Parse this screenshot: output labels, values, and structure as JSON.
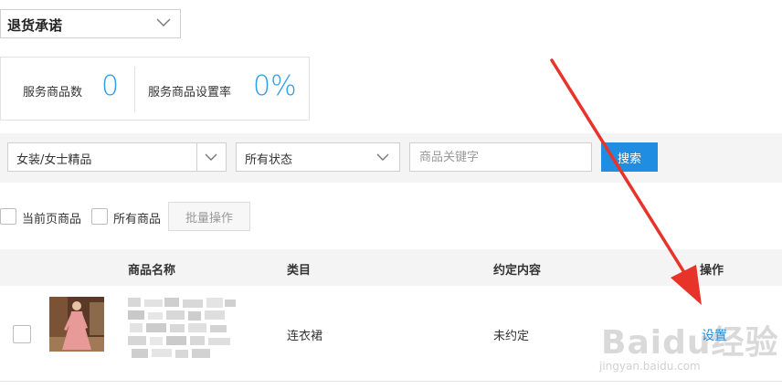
{
  "service_select": {
    "value": "退货承诺"
  },
  "stats": {
    "count_label": "服务商品数",
    "count_value": "0",
    "rate_label": "服务商品设置率",
    "rate_value": "0%"
  },
  "filters": {
    "category_value": "女装/女士精品",
    "status_value": "所有状态",
    "keyword_placeholder": "商品关键字",
    "search_label": "搜索"
  },
  "bulk": {
    "current_page_label": "当前页商品",
    "all_label": "所有商品",
    "batch_button": "批量操作"
  },
  "table": {
    "headers": [
      "商品名称",
      "类目",
      "约定内容",
      "操作"
    ],
    "rows": [
      {
        "category": "连衣裙",
        "agreement": "未约定",
        "action": "设置"
      }
    ]
  },
  "watermark": {
    "logo": "Baidu经验",
    "url": "jingyan.baidu.com"
  },
  "colors": {
    "accent": "#1f8de2",
    "stat_number": "#2d9de8",
    "arrow": "#e8332a"
  }
}
